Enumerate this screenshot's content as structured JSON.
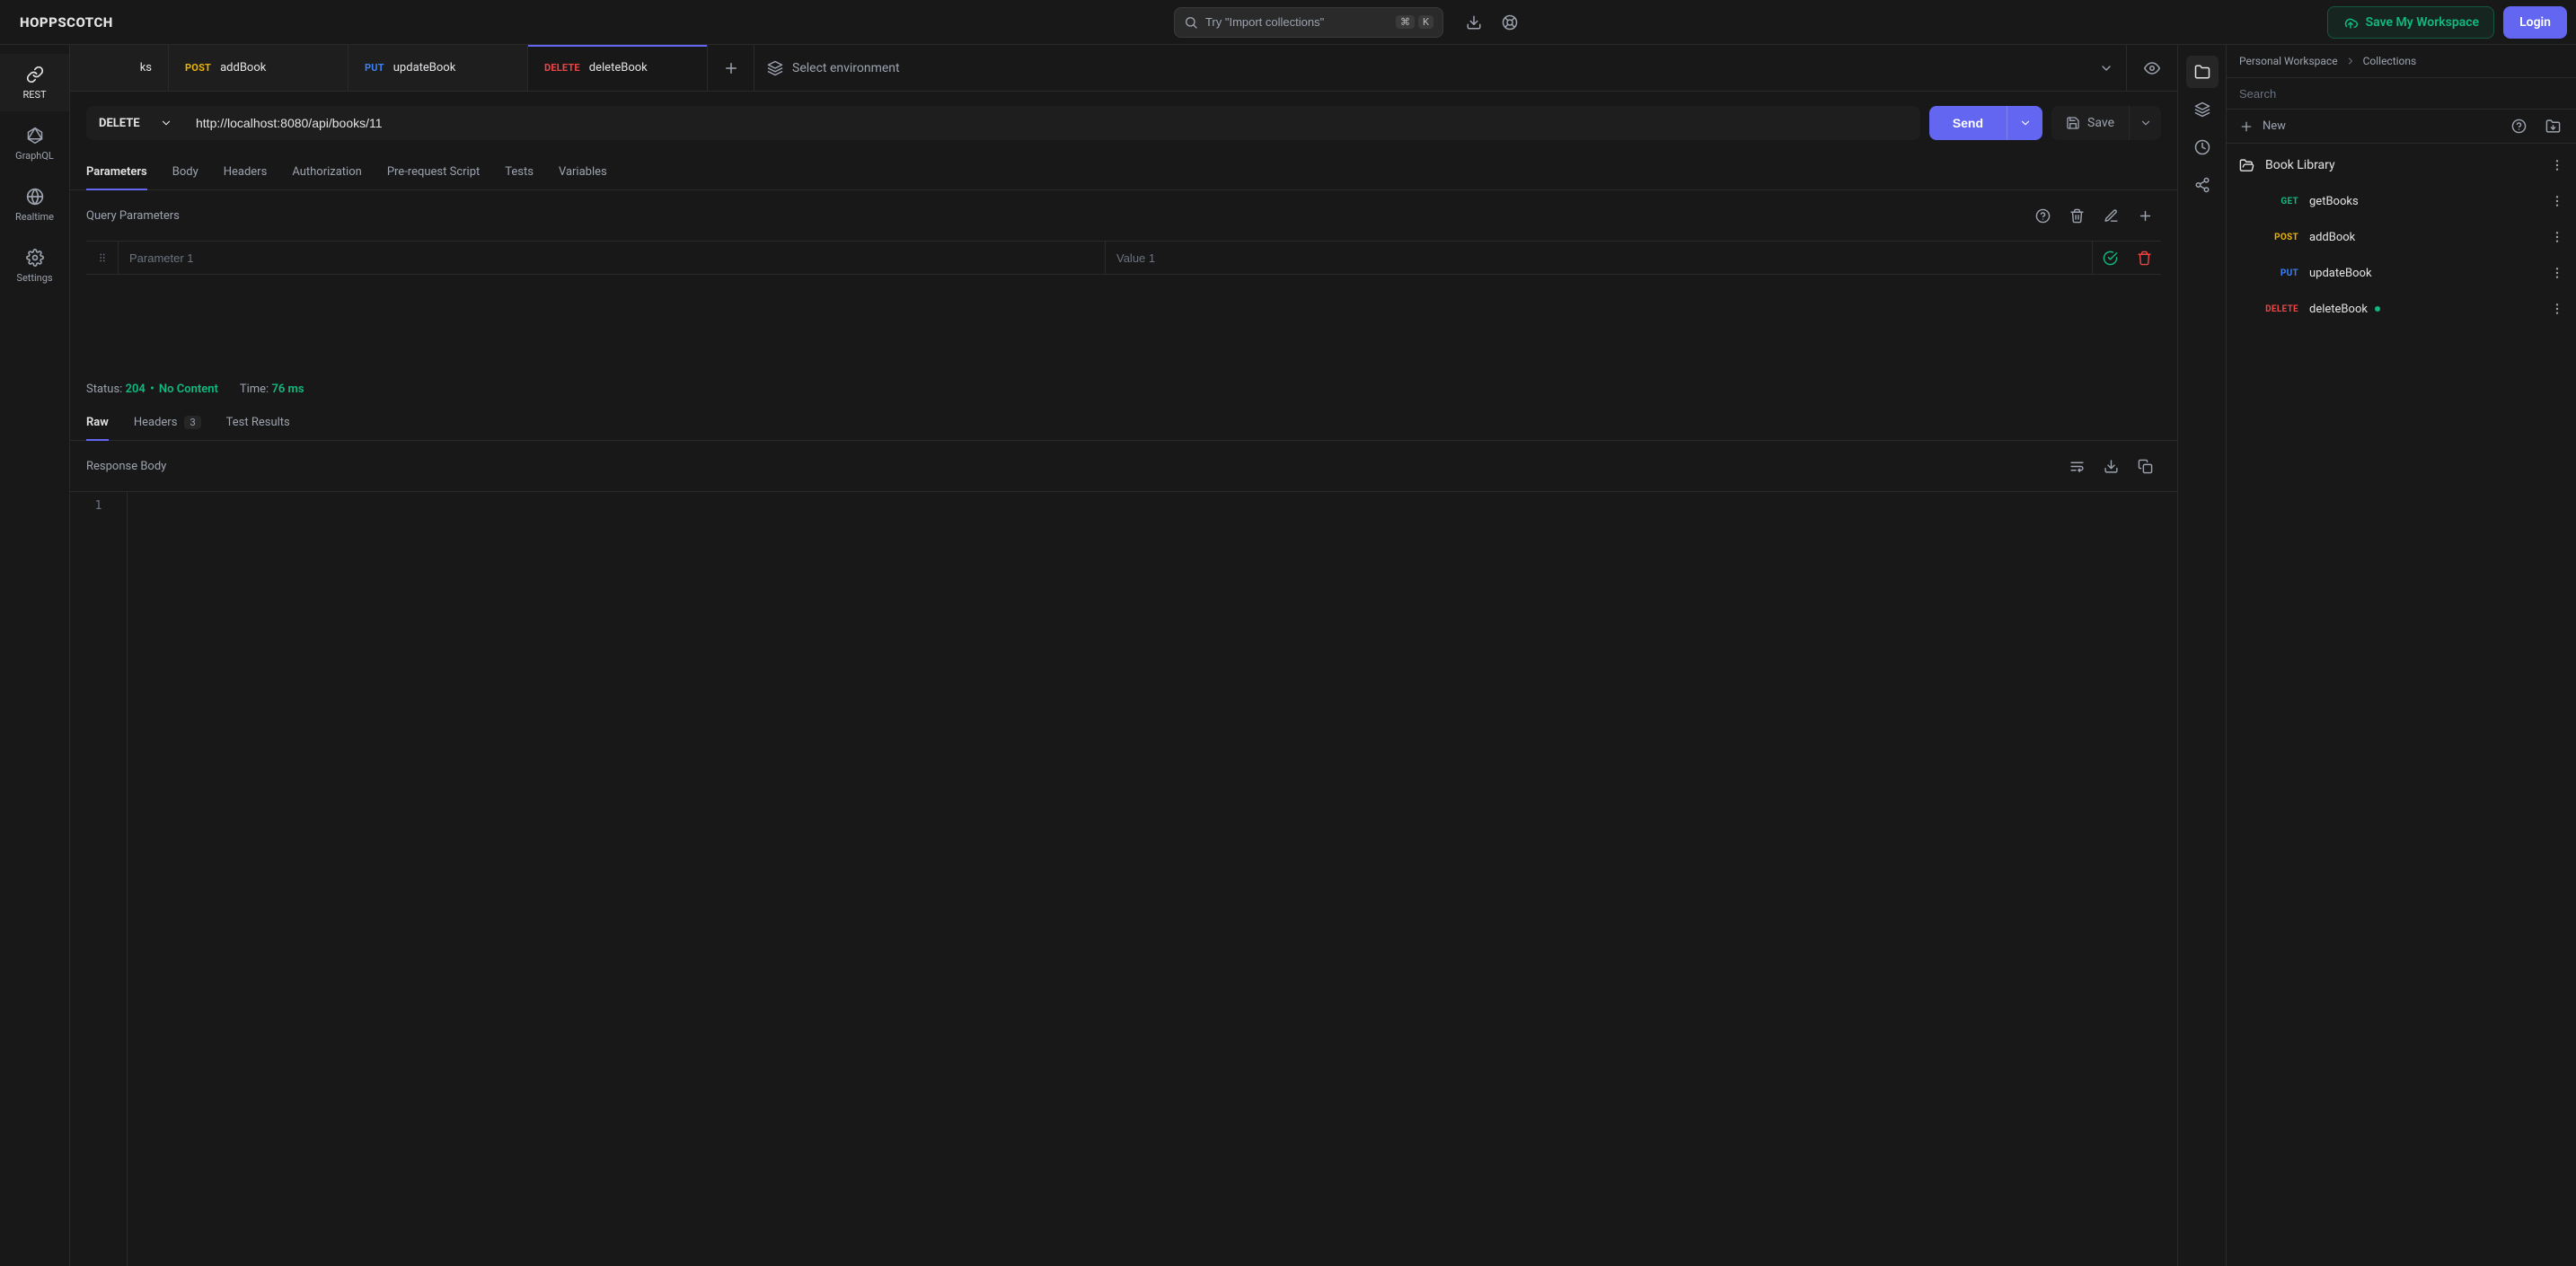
{
  "app": {
    "name": "HOPPSCOTCH"
  },
  "topbar": {
    "search_placeholder": "Try \"Import collections\"",
    "shortcut_mod": "⌘",
    "shortcut_key": "K",
    "save_workspace": "Save My Workspace",
    "login": "Login"
  },
  "leftrail": {
    "items": [
      {
        "id": "rest",
        "label": "REST"
      },
      {
        "id": "graphql",
        "label": "GraphQL"
      },
      {
        "id": "realtime",
        "label": "Realtime"
      },
      {
        "id": "settings",
        "label": "Settings"
      }
    ]
  },
  "tabs": [
    {
      "method": "",
      "label": "ks",
      "partial": true
    },
    {
      "method": "POST",
      "label": "addBook"
    },
    {
      "method": "PUT",
      "label": "updateBook"
    },
    {
      "method": "DELETE",
      "label": "deleteBook",
      "active": true
    }
  ],
  "env": {
    "label": "Select environment"
  },
  "request": {
    "method": "DELETE",
    "url": "http://localhost:8080/api/books/11",
    "send": "Send",
    "save": "Save"
  },
  "req_tabs": [
    "Parameters",
    "Body",
    "Headers",
    "Authorization",
    "Pre-request Script",
    "Tests",
    "Variables"
  ],
  "query_params": {
    "heading": "Query Parameters",
    "rows": [
      {
        "key_placeholder": "Parameter 1",
        "value_placeholder": "Value 1"
      }
    ]
  },
  "response": {
    "status_label": "Status:",
    "status_code": "204",
    "status_sep": "•",
    "status_text": "No Content",
    "time_label": "Time:",
    "time_value": "76 ms",
    "tabs": {
      "raw": "Raw",
      "headers": "Headers",
      "headers_count": "3",
      "test_results": "Test Results"
    },
    "body_heading": "Response Body",
    "gutter_line": "1"
  },
  "rightpanel": {
    "crumbs": [
      "Personal Workspace",
      "Collections"
    ],
    "search_placeholder": "Search",
    "new_label": "New",
    "collection": {
      "name": "Book Library",
      "requests": [
        {
          "method": "GET",
          "name": "getBooks"
        },
        {
          "method": "POST",
          "name": "addBook"
        },
        {
          "method": "PUT",
          "name": "updateBook"
        },
        {
          "method": "DELETE",
          "name": "deleteBook",
          "active": true
        }
      ]
    }
  }
}
